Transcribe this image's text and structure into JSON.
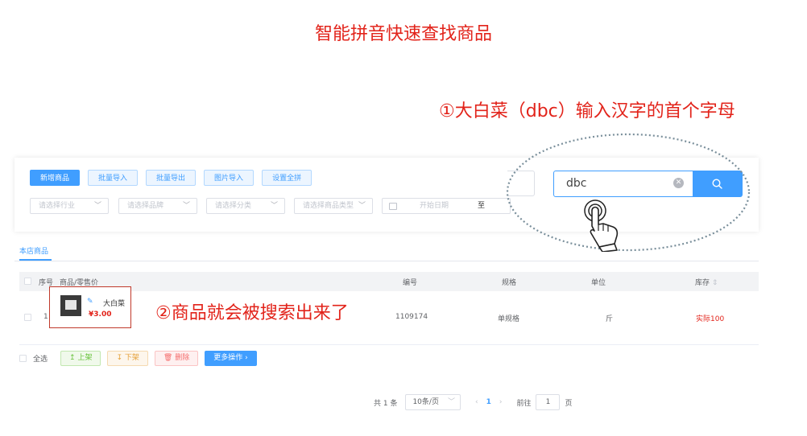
{
  "headline": "智能拼音快速查找商品",
  "annotations": {
    "step1": "①大白菜（dbc）输入汉字的首个字母",
    "step2": "②商品就会被搜索出来了"
  },
  "toolbar": {
    "buttons": [
      "新增商品",
      "批量导入",
      "批量导出",
      "图片导入",
      "设置全拼"
    ]
  },
  "filters": {
    "industry": "请选择行业",
    "brand": "请选择品牌",
    "category": "请选择分类",
    "product_type": "请选择商品类型",
    "start_date": "开始日期",
    "to": "至"
  },
  "search": {
    "value": "dbc",
    "clear_icon": "circle-x-icon",
    "button_icon": "search-icon"
  },
  "tabs": [
    "本店商品"
  ],
  "table": {
    "headers": {
      "index": "序号",
      "product": "商品/零售价",
      "code": "编号",
      "spec": "规格",
      "unit": "单位",
      "stock": "库存"
    },
    "rows": [
      {
        "index": "1",
        "name": "大白菜",
        "price": "¥3.00",
        "code": "1109174",
        "spec": "单规格",
        "unit": "斤",
        "stock": "实际100"
      }
    ]
  },
  "bulk": {
    "select_all": "全选",
    "up": "上架",
    "down": "下架",
    "delete": "删除",
    "more": "更多操作 ›"
  },
  "pagination": {
    "total": "共 1 条",
    "page_size": "10条/页",
    "current": "1",
    "goto_label": "前往",
    "goto_value": "1",
    "page_suffix": "页"
  },
  "colors": {
    "accent": "#409eff",
    "annotation": "#e2231a"
  }
}
